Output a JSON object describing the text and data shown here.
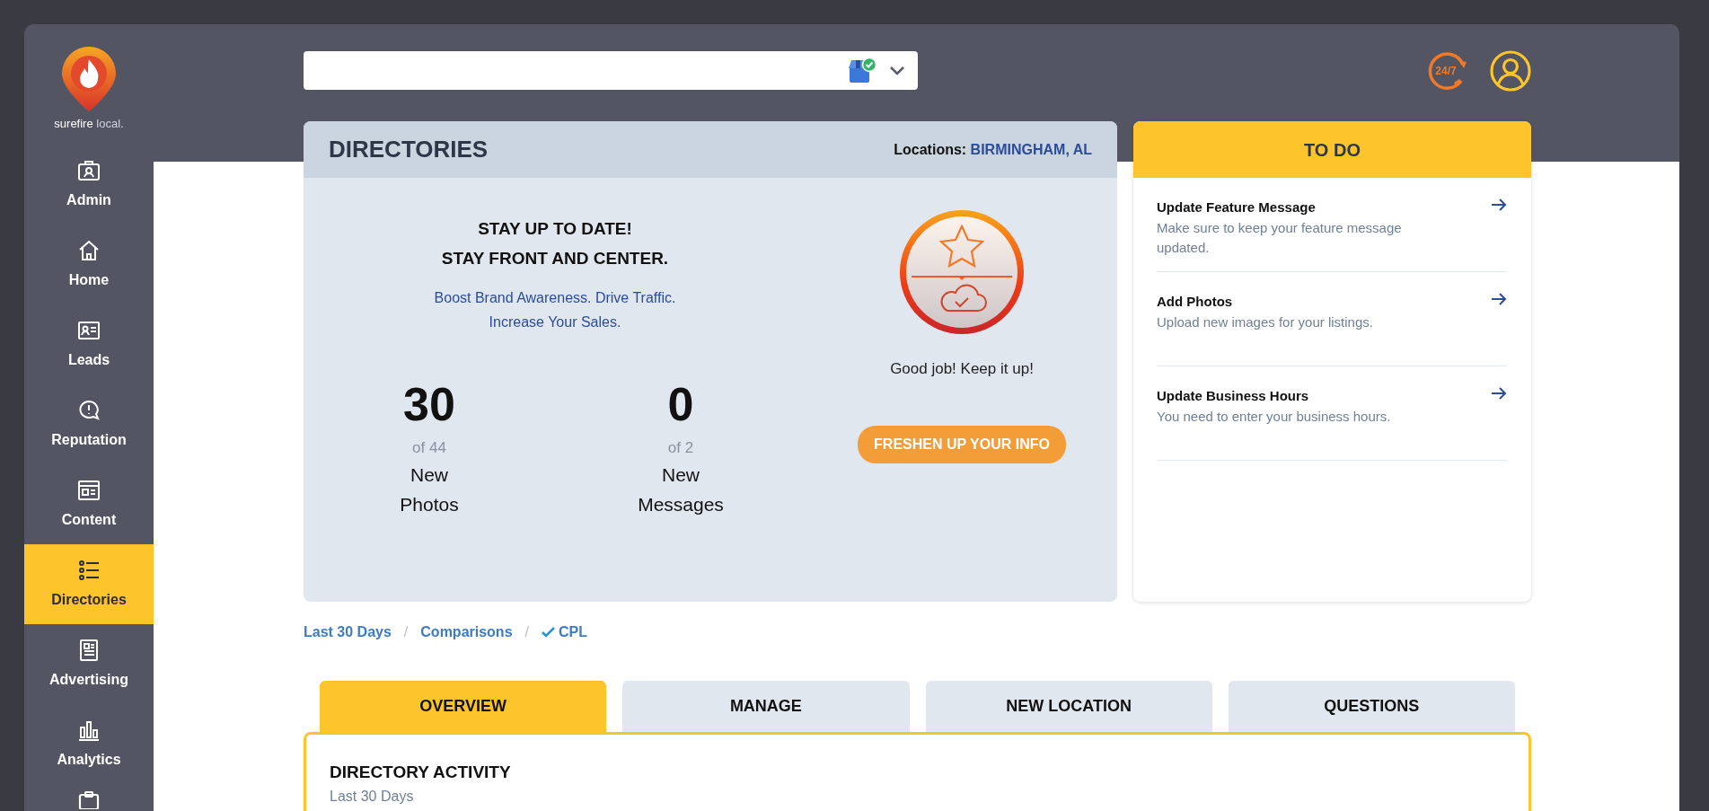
{
  "sidebar": {
    "logo": {
      "name": "surefire",
      "suffix": "local."
    },
    "items": [
      {
        "label": "Admin",
        "selected": false
      },
      {
        "label": "Home",
        "selected": false
      },
      {
        "label": "Leads",
        "selected": false
      },
      {
        "label": "Reputation",
        "selected": false
      },
      {
        "label": "Content",
        "selected": false
      },
      {
        "label": "Directories",
        "selected": true
      },
      {
        "label": "Advertising",
        "selected": false
      },
      {
        "label": "Analytics",
        "selected": false
      }
    ]
  },
  "top_bar": {
    "support_badge": "24/7"
  },
  "directories_card": {
    "title": "DIRECTORIES",
    "locations_label": "Locations:",
    "location": "BIRMINGHAM, AL",
    "headline": [
      "STAY UP TO DATE!",
      "STAY FRONT AND CENTER."
    ],
    "tagline": [
      "Boost Brand Awareness. Drive Traffic.",
      "Increase Your Sales."
    ],
    "stats": [
      {
        "value": "30",
        "total": "of 44",
        "label": "New Photos"
      },
      {
        "value": "0",
        "total": "of 2",
        "label": "New Messages"
      }
    ],
    "status": "Good job! Keep it up!",
    "button": "FRESHEN UP YOUR INFO"
  },
  "todo": {
    "title": "TO DO",
    "items": [
      {
        "title": "Update Feature Message",
        "description": "Make sure to keep your feature message updated."
      },
      {
        "title": "Add Photos",
        "description": "Upload new images for your listings."
      },
      {
        "title": "Update Business Hours",
        "description": "You need to enter your business hours."
      }
    ]
  },
  "breadcrumb": {
    "separator": "/",
    "items": [
      {
        "label": "Last 30 Days",
        "checked": false
      },
      {
        "label": "Comparisons",
        "checked": false
      },
      {
        "label": "CPL",
        "checked": true
      }
    ]
  },
  "tabs": [
    {
      "label": "OVERVIEW",
      "selected": true
    },
    {
      "label": "MANAGE",
      "selected": false
    },
    {
      "label": "NEW LOCATION",
      "selected": false
    },
    {
      "label": "QUESTIONS",
      "selected": false
    }
  ],
  "panel": {
    "title": "DIRECTORY ACTIVITY",
    "subtitle": "Last 30 Days"
  }
}
